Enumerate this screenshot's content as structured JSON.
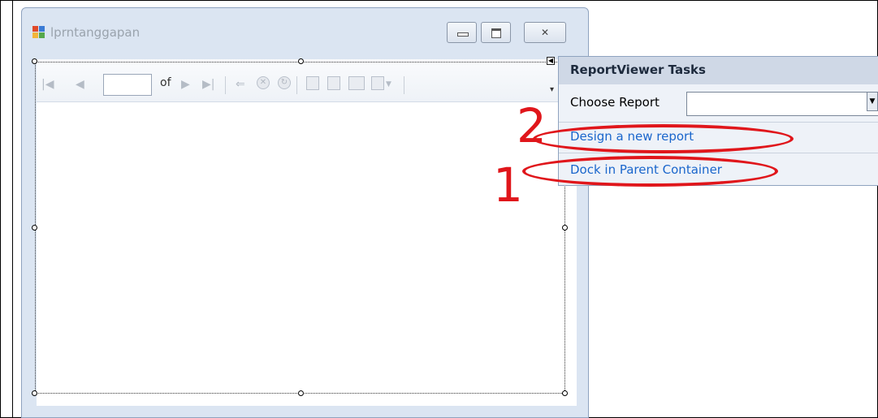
{
  "window": {
    "title": "lprntanggapan",
    "controls": [
      "minimize",
      "maximize",
      "close"
    ]
  },
  "toolbar": {
    "page_input_value": "",
    "of_label": "of",
    "icons": [
      "first-page-icon",
      "previous-page-icon",
      "next-page-icon",
      "last-page-icon",
      "back-icon",
      "stop-icon",
      "refresh-icon",
      "print-icon",
      "print-layout-icon",
      "page-setup-icon",
      "export-icon"
    ]
  },
  "tasks_panel": {
    "title": "ReportViewer Tasks",
    "choose_report_label": "Choose Report",
    "choose_report_value": "",
    "links": {
      "design": "Design a new report",
      "dock": "Dock in Parent Container"
    }
  },
  "annotations": {
    "step_one": "1",
    "step_two": "2",
    "color": "#e0161b"
  }
}
